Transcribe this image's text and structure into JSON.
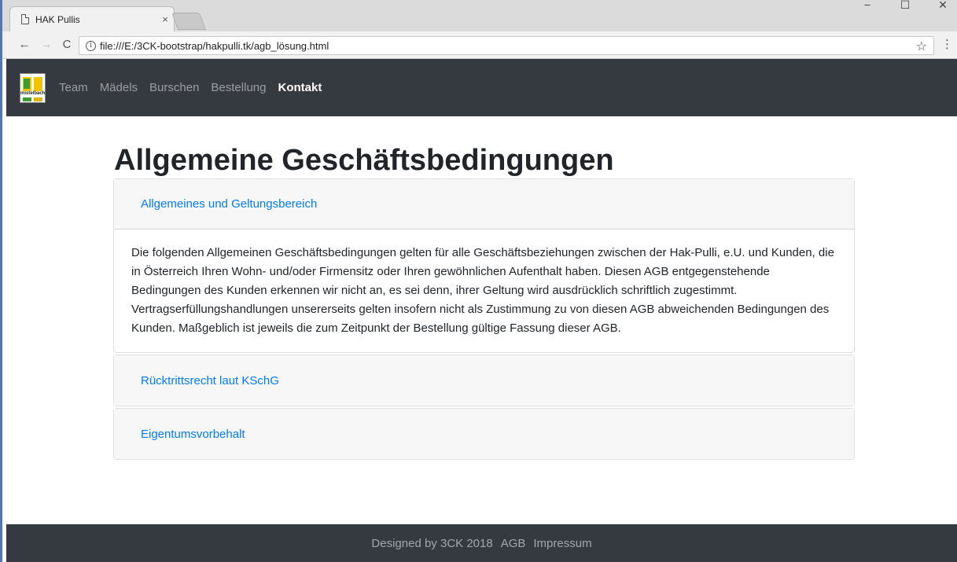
{
  "browser": {
    "tab_title": "HAK Pullis",
    "tab_close": "×",
    "url": "file:///E:/3CK-bootstrap/hakpulli.tk/agb_lösung.html",
    "window_controls": [
      "−",
      "☐",
      "✕"
    ]
  },
  "navbar": {
    "brand_logo_text": "mistelbach",
    "items": [
      {
        "label": "Team",
        "active": false
      },
      {
        "label": "Mädels",
        "active": false
      },
      {
        "label": "Burschen",
        "active": false
      },
      {
        "label": "Bestellung",
        "active": false
      },
      {
        "label": "Kontakt",
        "active": true
      }
    ]
  },
  "main": {
    "heading": "Allgemeine Geschäftsbedingungen",
    "sections": [
      {
        "title": "Allgemeines und Geltungsbereich",
        "expanded": true,
        "body": "Die folgenden Allgemeinen Geschäftsbedingungen gelten für alle Geschäftsbeziehungen zwischen der Hak-Pulli, e.U. und Kunden, die in Österreich Ihren Wohn- und/oder Firmensitz oder Ihren gewöhnlichen Aufenthalt haben. Diesen AGB entgegenstehende Bedingungen des Kunden erkennen wir nicht an, es sei denn, ihrer Geltung wird ausdrücklich schriftlich zugestimmt. Vertragserfüllungshandlungen unsererseits gelten insofern nicht als Zustimmung zu von diesen AGB abweichenden Bedingungen des Kunden. Maßgeblich ist jeweils die zum Zeitpunkt der Bestellung gültige Fassung dieser AGB."
      },
      {
        "title": "Rücktrittsrecht laut KSchG",
        "expanded": false
      },
      {
        "title": "Eigentumsvorbehalt",
        "expanded": false
      }
    ]
  },
  "footer": {
    "credit": "Designed by 3CK 2018",
    "agb_link": "AGB",
    "impressum_link": "Impressum"
  },
  "colors": {
    "navbar_bg": "#343a40",
    "link": "#007bff"
  }
}
